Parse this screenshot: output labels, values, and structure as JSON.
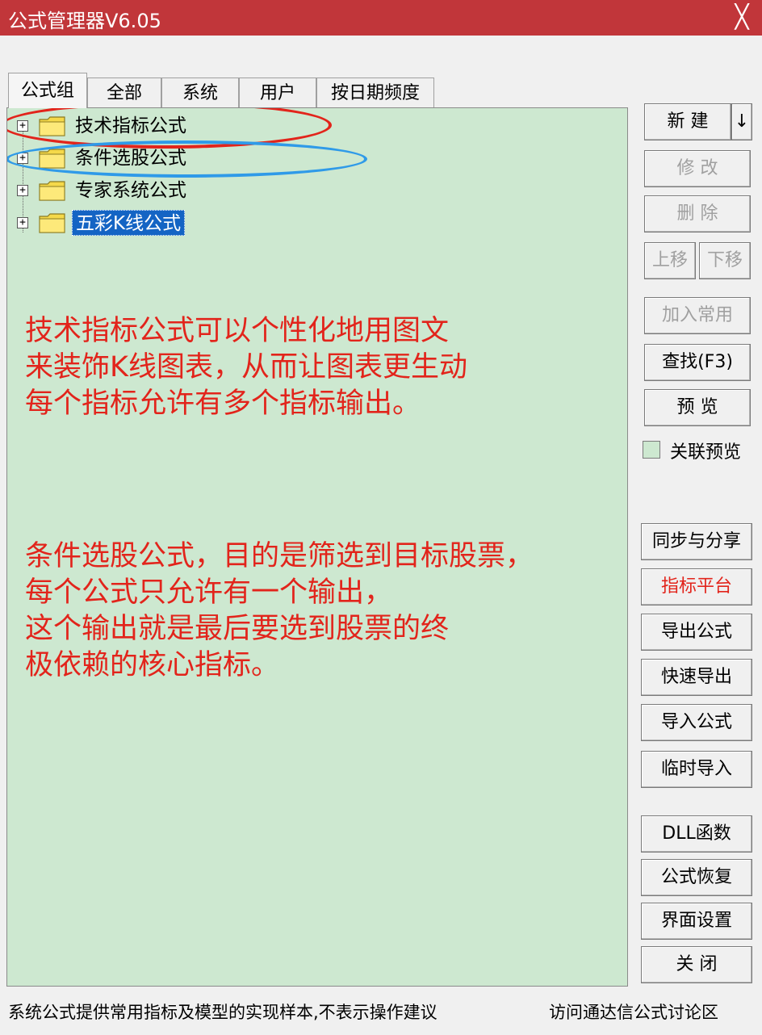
{
  "window": {
    "title": "公式管理器V6.05",
    "close_glyph": "╳"
  },
  "tabs": [
    {
      "label": "公式组",
      "active": true
    },
    {
      "label": "全部",
      "active": false
    },
    {
      "label": "系统",
      "active": false
    },
    {
      "label": "用户",
      "active": false
    },
    {
      "label": "按日期频度",
      "active": false
    }
  ],
  "tree": {
    "nodes": [
      {
        "label": "技术指标公式",
        "selected": false
      },
      {
        "label": "条件选股公式",
        "selected": false
      },
      {
        "label": "专家系统公式",
        "selected": false
      },
      {
        "label": "五彩K线公式",
        "selected": true
      }
    ],
    "expander_glyph": "+"
  },
  "annotations": {
    "note1": [
      "技术指标公式可以个性化地用图文",
      "来装饰K线图表，从而让图表更生动",
      "每个指标允许有多个指标输出。"
    ],
    "note2": [
      "条件选股公式，目的是筛选到目标股票，",
      "每个公式只允许有一个输出，",
      "这个输出就是最后要选到股票的终",
      "极依赖的核心指标。"
    ],
    "text_color": "#e2241b",
    "circle_colors": {
      "tech": "#e2241b",
      "select": "#2f9ae8"
    }
  },
  "buttons": {
    "new": "新 建",
    "new_arrow": "↓",
    "modify": "修 改",
    "delete": "删 除",
    "move_up": "上移",
    "move_down": "下移",
    "add_common": "加入常用",
    "find": "查找(F3)",
    "preview": "预 览",
    "sync_share": "同步与分享",
    "indicator_platform": "指标平台",
    "export_formula": "导出公式",
    "quick_export": "快速导出",
    "import_formula": "导入公式",
    "temp_import": "临时导入",
    "dll_functions": "DLL函数",
    "restore_formula": "公式恢复",
    "ui_settings": "界面设置",
    "close": "关 闭"
  },
  "linked_preview": {
    "label": "关联预览",
    "checked": false
  },
  "status": {
    "left": "系统公式提供常用指标及模型的实现样本,不表示操作建议",
    "right": "访问通达信公式讨论区"
  },
  "colors": {
    "titlebar": "#c1363a",
    "tree_bg": "#cde8d0",
    "selection": "#1464c4"
  }
}
